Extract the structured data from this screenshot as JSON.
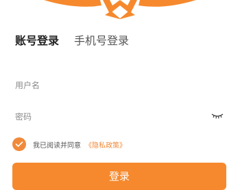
{
  "brand": {
    "logo_icon": "brand-logo",
    "accent_color": "#f6892d"
  },
  "tabs": [
    {
      "label": "账号登录",
      "active": true
    },
    {
      "label": "手机号登录",
      "active": false
    }
  ],
  "form": {
    "username": {
      "placeholder": "用户名",
      "value": ""
    },
    "password": {
      "placeholder": "密码",
      "value": "",
      "toggle_icon": "eye-closed-icon"
    }
  },
  "agreement": {
    "checked": true,
    "text": "我已阅读并同意",
    "link_label": "《隐私政策》"
  },
  "login_button": {
    "label": "登录"
  }
}
